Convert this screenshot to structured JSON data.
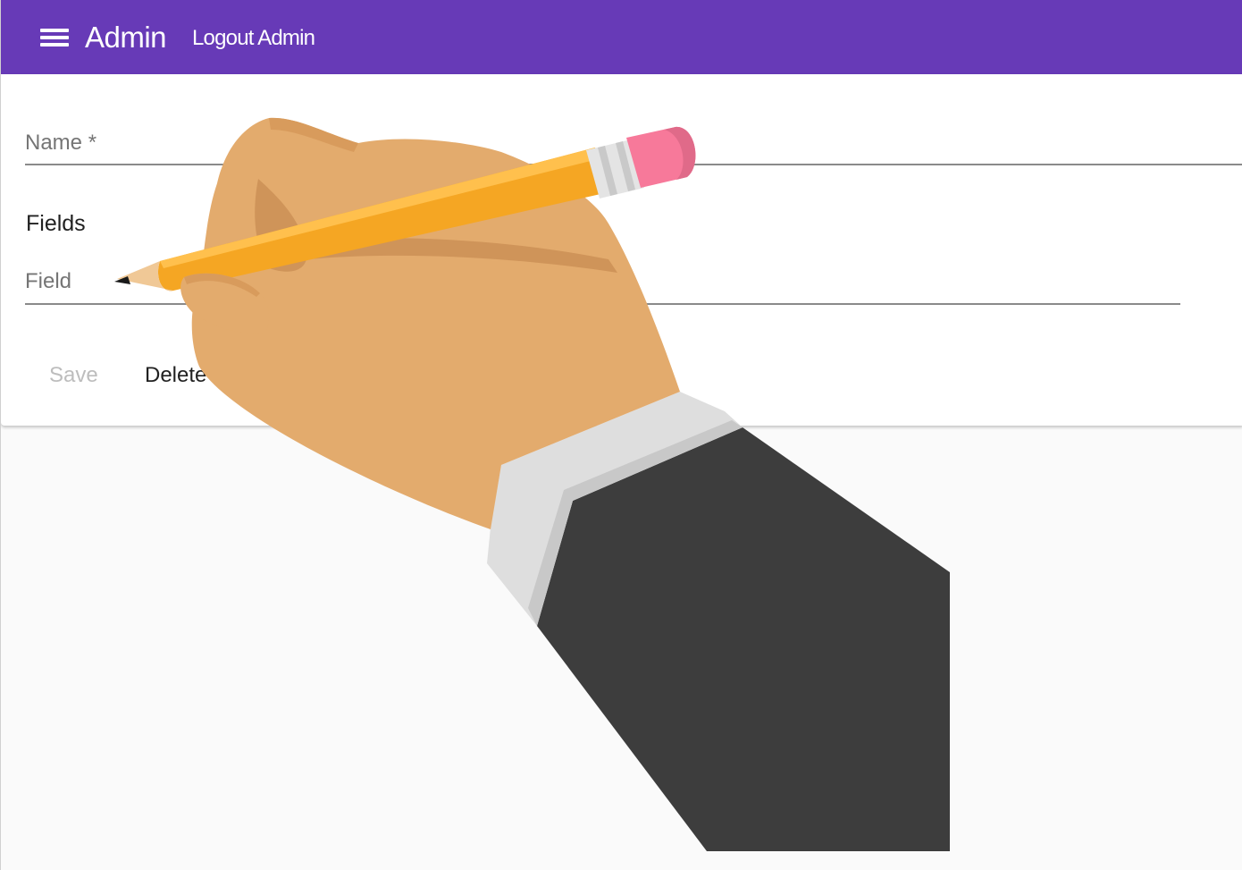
{
  "appbar": {
    "title": "Admin",
    "logout_label": "Logout Admin",
    "background_color": "#673ab7",
    "menu_icon": "menu-icon"
  },
  "form": {
    "name_field": {
      "label": "Name *",
      "value": ""
    },
    "fields_section": {
      "title": "Fields"
    },
    "field_input": {
      "label": "Field",
      "value": ""
    },
    "save_label": "Save",
    "delete_label": "Delete"
  },
  "overlay": {
    "illustration": "hand-writing-with-pencil"
  }
}
